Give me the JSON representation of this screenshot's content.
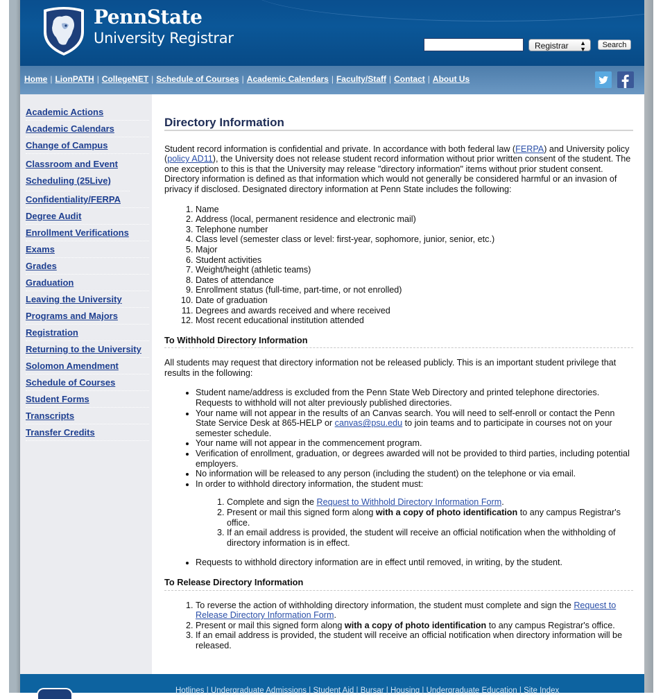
{
  "header": {
    "brand_title": "PennState",
    "brand_subtitle": "University Registrar",
    "search": {
      "value": "",
      "placeholder": "",
      "scope_selected": "Registrar",
      "button_label": "Search"
    }
  },
  "nav": {
    "links": [
      "Home",
      "LionPATH",
      "CollegeNET",
      "Schedule of Courses",
      "Academic Calendars",
      "Faculty/Staff",
      "Contact",
      "About Us"
    ],
    "separator": "|",
    "social": [
      "twitter-icon",
      "facebook-icon"
    ]
  },
  "sidebar": {
    "items": [
      "Academic Actions",
      "Academic Calendars",
      "Change of Campus",
      "Classroom and Event Scheduling (25Live)",
      "Confidentiality/FERPA",
      "Degree Audit",
      "Enrollment Verifications",
      "Exams",
      "Grades",
      "Graduation",
      "Leaving the University",
      "Programs and Majors",
      "Registration",
      "Returning to the University",
      "Solomon Amendment",
      "Schedule of Courses",
      "Student Forms",
      "Transcripts",
      "Transfer Credits"
    ]
  },
  "main": {
    "title": "Directory Information",
    "intro": {
      "t1": "Student record information is confidential and private. In accordance with both federal law (",
      "link1": "FERPA",
      "t2": ") and University policy (",
      "link2": "policy AD11",
      "t3": "), the University does not release student record information without prior written consent of the student. The one exception to this is that the University may release \"directory information\" items without prior student consent. Directory information is defined as that information which would not generally be considered harmful or an invasion of privacy if disclosed. Designated directory information at Penn State includes the following:"
    },
    "directory_items": [
      "Name",
      "Address (local, permanent residence and electronic mail)",
      "Telephone number",
      "Class level (semester class or level: first-year, sophomore, junior, senior, etc.)",
      "Major",
      "Student activities",
      "Weight/height (athletic teams)",
      "Dates of attendance",
      "Enrollment status (full-time, part-time, or not enrolled)",
      "Date of graduation",
      "Degrees and awards received and where received",
      "Most recent educational institution attended"
    ],
    "withhold": {
      "heading": "To Withhold Directory Information",
      "intro": "All students may request that directory information not be released publicly. This is an important student privilege that results in the following:",
      "b1": "Student name/address is excluded from the Penn State Web Directory and printed telephone directories. Requests to withhold will not alter previously published directories.",
      "b2_t1": "Your name will not appear in the results of an Canvas search. You will need to self-enroll or contact the Penn State Service Desk at 865-HELP or ",
      "b2_link": "canvas@psu.edu",
      "b2_t2": " to join teams and to participate in courses not on your semester schedule.",
      "b3": "Your name will not appear in the commencement program.",
      "b4": "Verification of enrollment, graduation, or degrees awarded will not be provided to third parties, including potential employers.",
      "b5": "No information will be released to any person (including the student) on the telephone or via email.",
      "b6": "In order to withhold directory information, the student must:",
      "steps": {
        "s1_t1": "Complete and sign the ",
        "s1_link": "Request to Withhold Directory Information Form",
        "s1_t2": ".",
        "s2_t1": "Present or mail this signed form along ",
        "s2_bold": "with a copy of photo identification",
        "s2_t2": " to any campus Registrar's office.",
        "s3": "If an email address is provided, the student will receive an official notification when the withholding of directory information is in effect."
      },
      "b7": "Requests to withhold directory information are in effect until removed, in writing, by the student."
    },
    "release": {
      "heading": "To Release Directory Information",
      "s1_t1": "To reverse the action of withholding directory information, the student must complete and sign the ",
      "s1_link": "Request to Release Directory Information Form",
      "s1_t2": ".",
      "s2_t1": "Present or mail this signed form along ",
      "s2_bold": "with a copy of photo identification",
      "s2_t2": " to any campus Registrar's office.",
      "s3": "If an email address is provided, the student will receive an official notification when directory information will be released."
    }
  },
  "footer": {
    "links": [
      "Hotlines",
      "Undergraduate Admissions",
      "Student Aid",
      "Bursar",
      "Housing",
      "Undergraduate Education",
      "Site Index"
    ],
    "separator": "|"
  },
  "colors": {
    "header_blue": "#0b5798",
    "nav_blue": "#5a89b6",
    "sidebar_link": "#1e3f90",
    "content_link": "#2a4fa8",
    "footer_blue": "#0d63a0"
  }
}
